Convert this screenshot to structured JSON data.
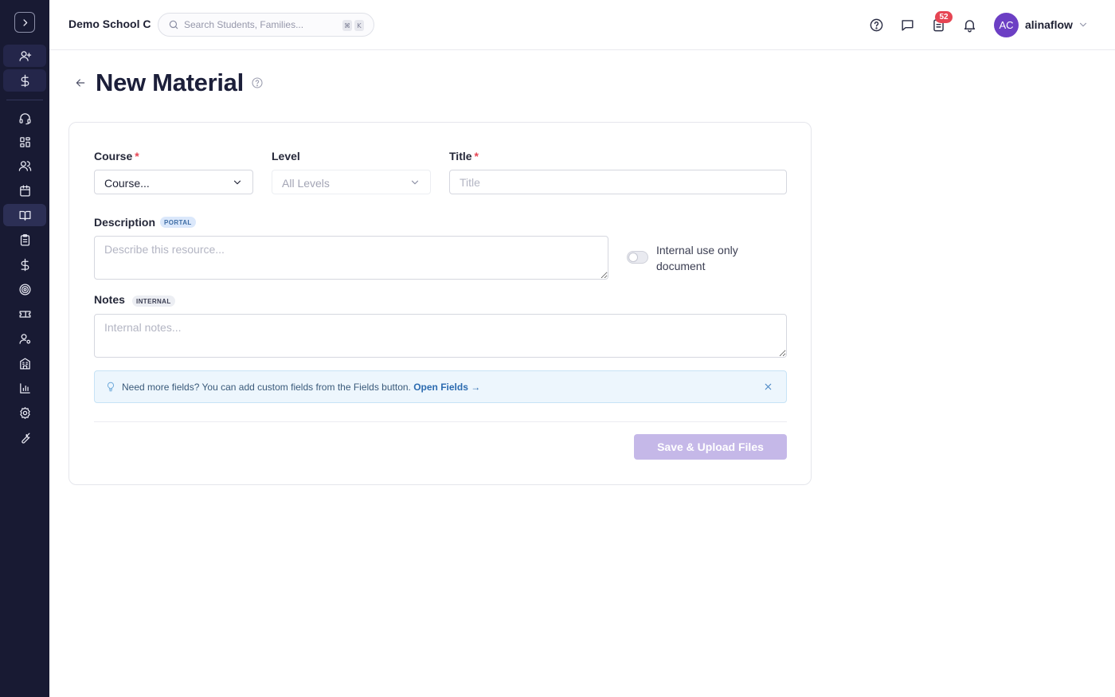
{
  "topbar": {
    "school_name": "Demo School C",
    "search_placeholder": "Search Students, Families...",
    "shortcut_keys": [
      "⌘",
      "K"
    ],
    "tasks_badge": "52",
    "user_initials": "AC",
    "username": "alinaflow"
  },
  "sidebar": {
    "items": [
      "expand-sidebar",
      "add-user",
      "billing",
      "support",
      "dashboard",
      "people",
      "calendar",
      "materials",
      "assignments",
      "finance",
      "goals",
      "tickets",
      "user-settings",
      "buildings",
      "reports",
      "settings",
      "tools"
    ],
    "active_item": "materials"
  },
  "page": {
    "title": "New Material"
  },
  "form": {
    "course_label": "Course",
    "course_required": "*",
    "course_value": "Course...",
    "level_label": "Level",
    "level_value": "All Levels",
    "title_label": "Title",
    "title_required": "*",
    "title_placeholder": "Title",
    "description_label": "Description",
    "description_badge": "PORTAL",
    "description_placeholder": "Describe this resource...",
    "internal_toggle_label": "Internal use only document",
    "internal_toggle_on": false,
    "notes_label": "Notes",
    "notes_badge": "INTERNAL",
    "notes_placeholder": "Internal notes...",
    "info_text": "Need more fields? You can add custom fields from the Fields button.",
    "info_link": "Open Fields →",
    "save_button": "Save & Upload Files"
  },
  "colors": {
    "sidebar_bg": "#181a33",
    "accent": "#6c3fc4",
    "badge": "#e64553",
    "save_disabled": "#c5b8e8",
    "info_bg": "#edf6fd"
  }
}
